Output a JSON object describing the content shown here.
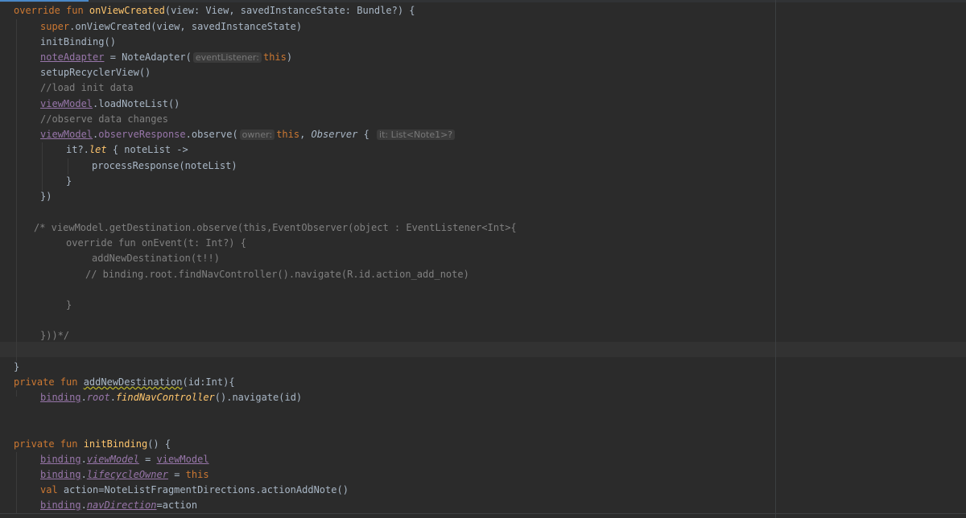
{
  "lines": [
    [
      "override",
      " fun ",
      "onViewCreated",
      "(view: View, savedInstanceState: Bundle?) {"
    ],
    [
      "super",
      ".onViewCreated(view, savedInstanceState)"
    ],
    [
      "initBinding()"
    ],
    [
      "noteAdapter",
      " = NoteAdapter(",
      "eventListener:",
      "this",
      ")"
    ],
    [
      "setupRecyclerView()"
    ],
    [
      "//load init data"
    ],
    [
      "viewModel",
      ".loadNoteList()"
    ],
    [
      "//observe data changes"
    ],
    [
      "viewModel",
      ".",
      "observeResponse",
      ".observe(",
      "owner:",
      "this",
      ", ",
      "Observer",
      " { ",
      "it: List<Note1>?"
    ],
    [
      "it?.",
      "let",
      " { noteList ->"
    ],
    [
      "processResponse(noteList)"
    ],
    [
      "}"
    ],
    [
      "})"
    ],
    [
      "/* viewModel.getDestination.observe(this,EventObserver(object : EventListener<Int>{"
    ],
    [
      "override fun onEvent(t: Int?) {"
    ],
    [
      "addNewDestination(t!!)"
    ],
    [
      "// binding.root.findNavController().navigate(R.id.action_add_note)"
    ],
    [
      "}"
    ],
    [
      "}))*/"
    ],
    [
      "}"
    ],
    [
      "private",
      " fun ",
      "addNewDestination",
      "(id:Int){"
    ],
    [
      "binding",
      ".",
      "root",
      ".",
      "findNavController",
      "().navigate(id)"
    ],
    [
      "private",
      " fun ",
      "initBinding",
      "() {"
    ],
    [
      "binding",
      ".",
      "viewModel",
      " = ",
      "viewModel"
    ],
    [
      "binding",
      ".",
      "lifecycleOwner",
      " = ",
      "this"
    ],
    [
      "val",
      " action=NoteListFragmentDirections.actionAddNote()"
    ],
    [
      "binding",
      ".",
      "navDirection",
      "=action"
    ]
  ]
}
